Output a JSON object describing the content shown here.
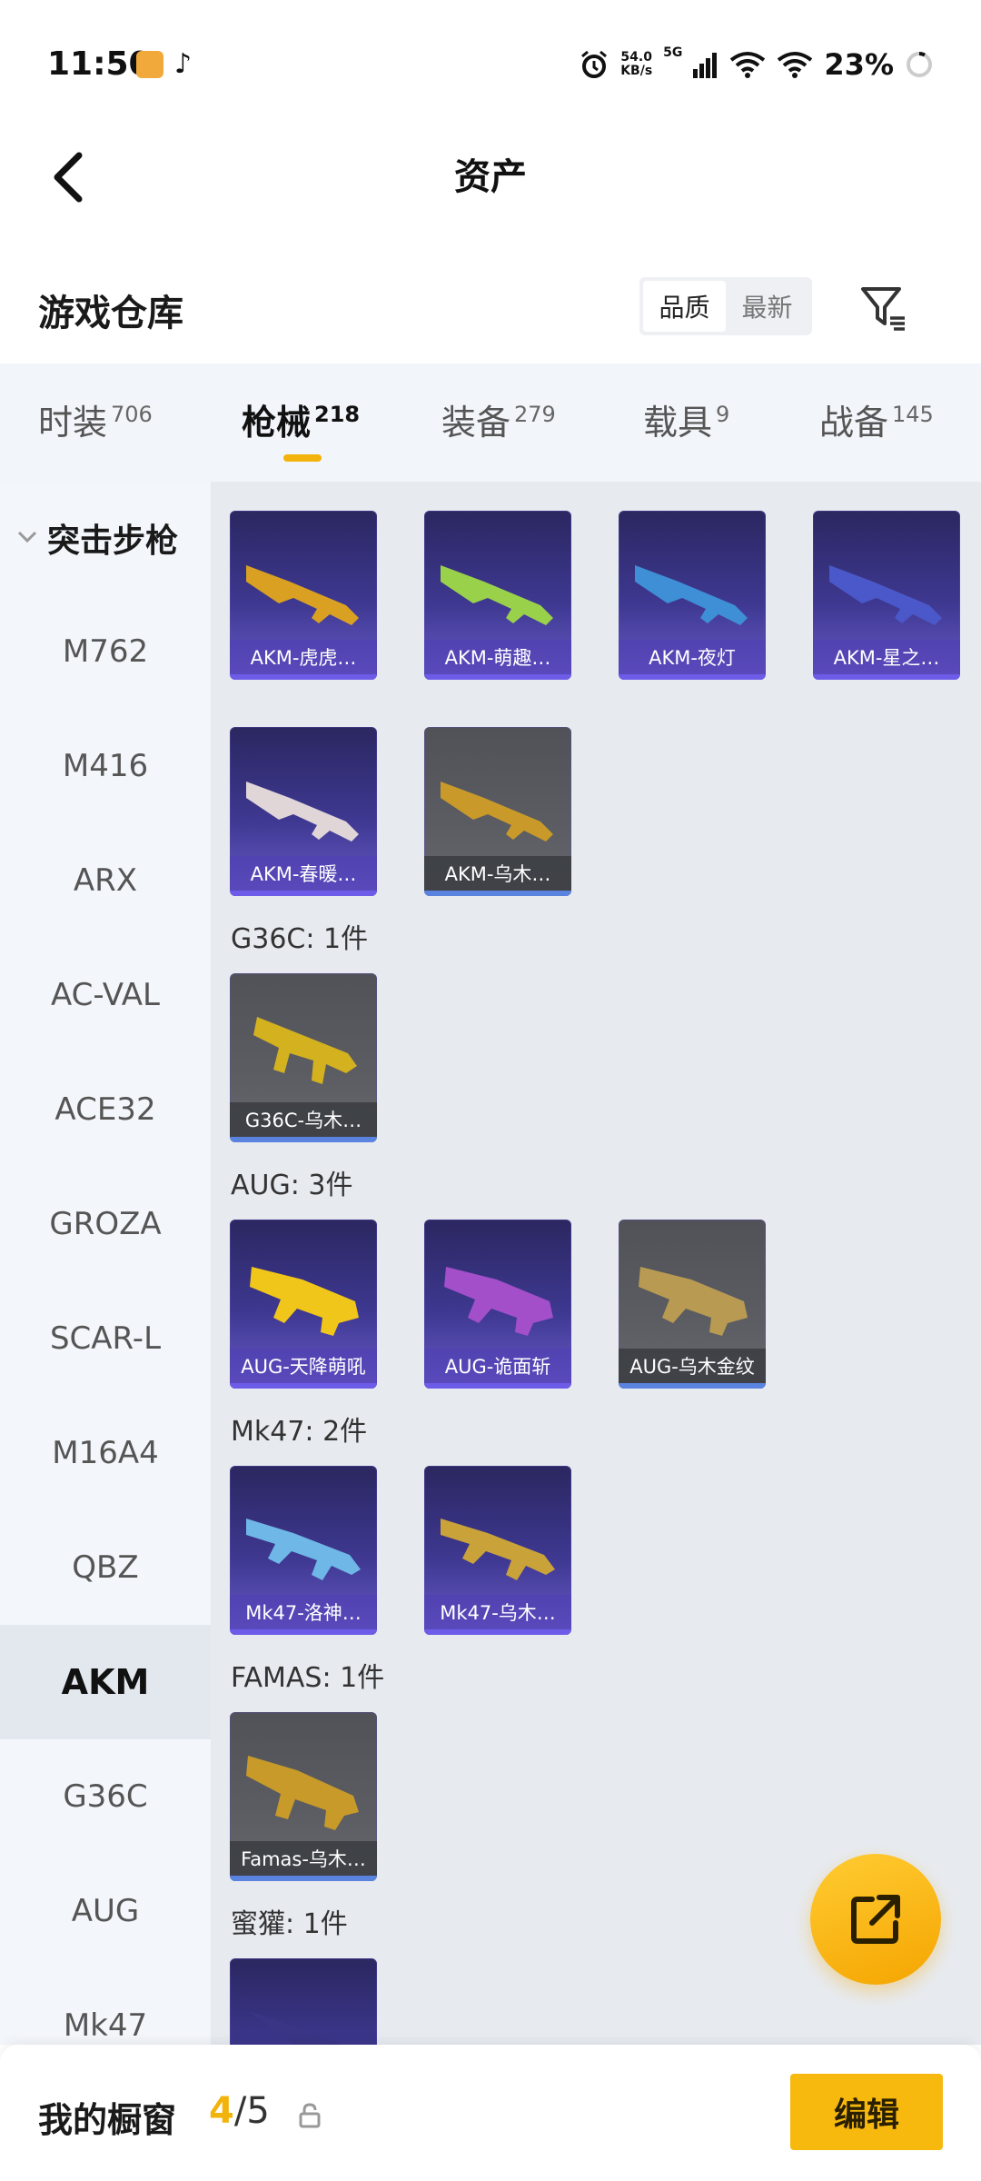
{
  "status_bar": {
    "time": "11:50",
    "net_speed_value": "54.0",
    "net_speed_unit": "KB/s",
    "network": "5G",
    "battery": "23%"
  },
  "header": {
    "title": "资产"
  },
  "section": {
    "title": "游戏仓库",
    "sort_options": [
      "品质",
      "最新"
    ],
    "sort_selected": "品质"
  },
  "tabs": [
    {
      "label": "时装",
      "count": "706"
    },
    {
      "label": "枪械",
      "count": "218"
    },
    {
      "label": "装备",
      "count": "279"
    },
    {
      "label": "载具",
      "count": "9"
    },
    {
      "label": "战备",
      "count": "145"
    }
  ],
  "active_tab": "枪械",
  "sidebar": {
    "group": "突击步枪",
    "items": [
      "M762",
      "M416",
      "ARX",
      "AC-VAL",
      "ACE32",
      "GROZA",
      "SCAR-L",
      "M16A4",
      "QBZ",
      "AKM",
      "G36C",
      "AUG",
      "Mk47"
    ],
    "active": "AKM"
  },
  "groups": [
    {
      "heading": "",
      "items": [
        {
          "name": "AKM-虎虎…",
          "rarity": "purple",
          "color": "#d9a021"
        },
        {
          "name": "AKM-萌趣…",
          "rarity": "purple",
          "color": "#9ad14a"
        },
        {
          "name": "AKM-夜灯",
          "rarity": "purple",
          "color": "#3e8fd6"
        },
        {
          "name": "AKM-星之…",
          "rarity": "purple",
          "color": "#4a58c9"
        },
        {
          "name": "AKM-春暖…",
          "rarity": "purple",
          "color": "#e0d6d8"
        },
        {
          "name": "AKM-乌木…",
          "rarity": "gray",
          "color": "#c99a2a"
        }
      ]
    },
    {
      "heading": "G36C: 1件",
      "items": [
        {
          "name": "G36C-乌木…",
          "rarity": "gray",
          "color": "#d4b11f"
        }
      ]
    },
    {
      "heading": "AUG: 3件",
      "items": [
        {
          "name": "AUG-天降萌吼",
          "rarity": "purple",
          "color": "#f0c61a"
        },
        {
          "name": "AUG-诡面斩",
          "rarity": "purple",
          "color": "#a24fc9"
        },
        {
          "name": "AUG-乌木金纹",
          "rarity": "gray",
          "color": "#b89a52"
        }
      ]
    },
    {
      "heading": "Mk47: 2件",
      "items": [
        {
          "name": "Mk47-洛神…",
          "rarity": "purple",
          "color": "#6fb7e6"
        },
        {
          "name": "Mk47-乌木…",
          "rarity": "purple",
          "color": "#c9a23a"
        }
      ]
    },
    {
      "heading": "FAMAS: 1件",
      "items": [
        {
          "name": "Famas-乌木…",
          "rarity": "gray",
          "color": "#c89a2a"
        }
      ]
    },
    {
      "heading": "蜜獾: 1件",
      "items": [
        {
          "name": "",
          "rarity": "purple",
          "color": "#3a3585"
        }
      ]
    }
  ],
  "bottom_bar": {
    "label": "我的橱窗",
    "current": "4",
    "total": "/5",
    "edit_label": "编辑"
  },
  "colors": {
    "accent": "#f7b90d",
    "purple_card": "#3e3891",
    "gray_card": "#5b5d63"
  }
}
